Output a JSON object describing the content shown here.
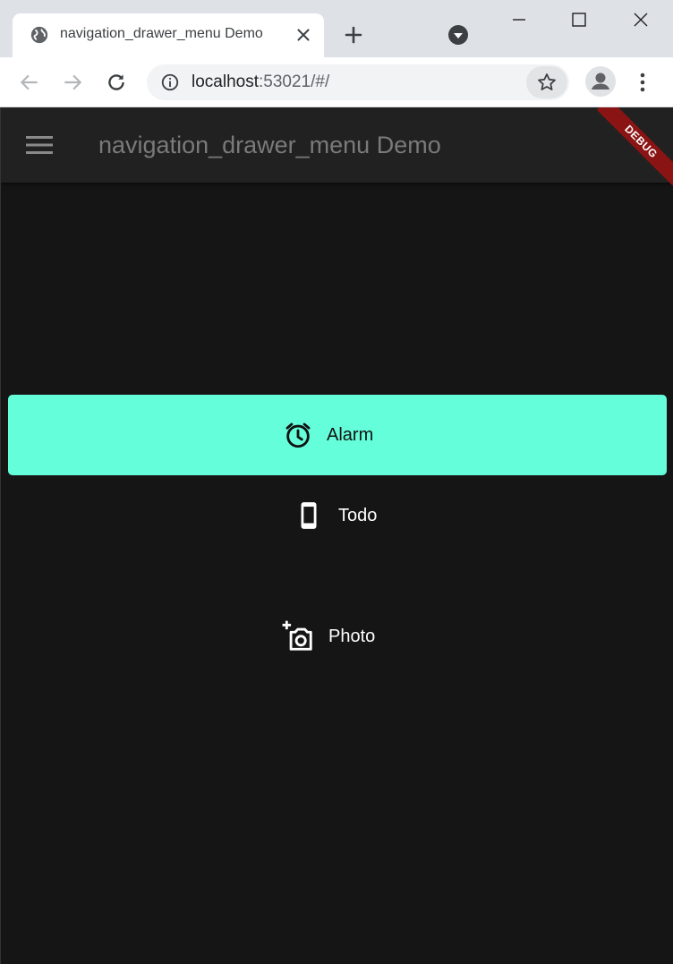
{
  "browser": {
    "tab_title": "navigation_drawer_menu Demo",
    "url_host": "localhost",
    "url_rest": ":53021/#/"
  },
  "app": {
    "title": "navigation_drawer_menu Demo",
    "debug_label": "DEBUG",
    "accent_color": "#64ffda",
    "background_color": "#151515",
    "appbar_color": "#212121",
    "menu_items": [
      {
        "label": "Alarm",
        "icon": "alarm-icon",
        "selected": true
      },
      {
        "label": "Todo",
        "icon": "phone-icon",
        "selected": false
      },
      {
        "label": "Photo",
        "icon": "add-a-photo-icon",
        "selected": false
      }
    ]
  }
}
